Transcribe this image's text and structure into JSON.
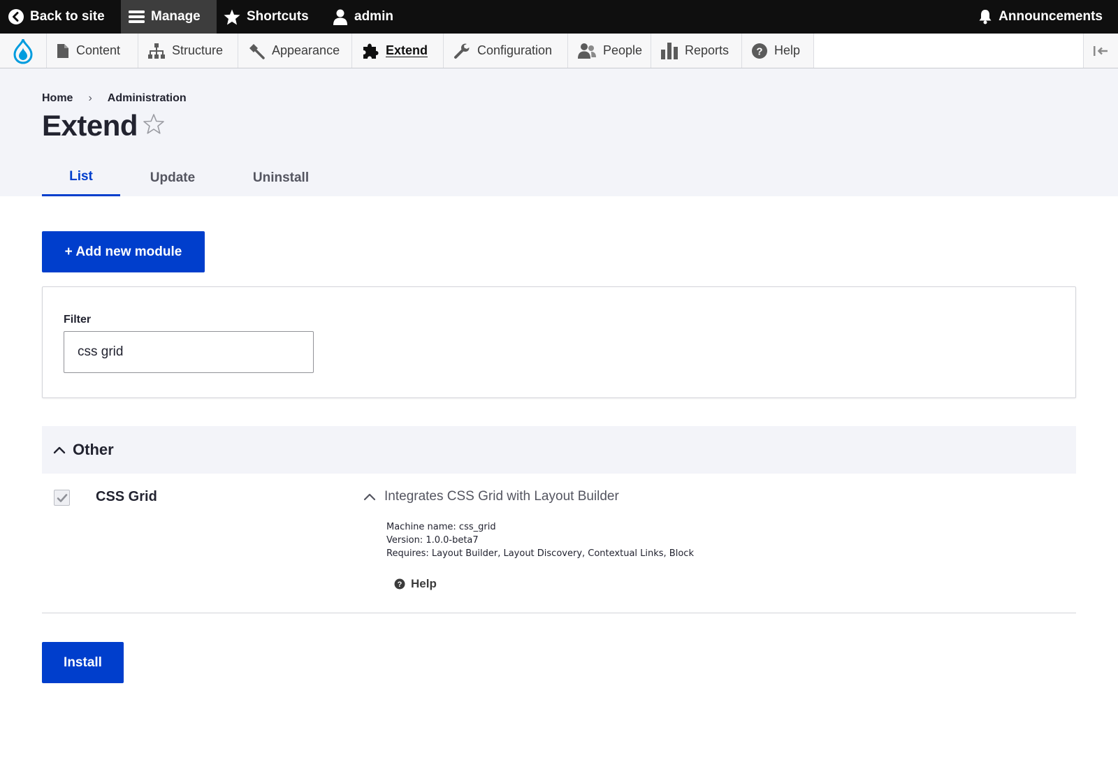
{
  "toolbar": {
    "back_label": "Back to site",
    "manage_label": "Manage",
    "shortcuts_label": "Shortcuts",
    "user_label": "admin",
    "announcements_label": "Announcements"
  },
  "tray": {
    "items": [
      {
        "label": "Content",
        "icon": "content-icon"
      },
      {
        "label": "Structure",
        "icon": "structure-icon"
      },
      {
        "label": "Appearance",
        "icon": "appearance-icon"
      },
      {
        "label": "Extend",
        "icon": "extend-icon",
        "active": true
      },
      {
        "label": "Configuration",
        "icon": "wrench-icon"
      },
      {
        "label": "People",
        "icon": "people-icon"
      },
      {
        "label": "Reports",
        "icon": "reports-icon"
      },
      {
        "label": "Help",
        "icon": "help-icon"
      }
    ]
  },
  "breadcrumb": {
    "home": "Home",
    "separator": "›",
    "current": "Administration"
  },
  "page": {
    "title": "Extend"
  },
  "tabs": [
    {
      "label": "List",
      "active": true
    },
    {
      "label": "Update"
    },
    {
      "label": "Uninstall"
    }
  ],
  "actions": {
    "add_module_label": "+ Add new module",
    "install_label": "Install"
  },
  "filter": {
    "label": "Filter",
    "value": "css grid"
  },
  "group": {
    "label": "Other"
  },
  "module": {
    "name": "CSS Grid",
    "checked": true,
    "description": "Integrates CSS Grid with Layout Builder",
    "machine_name": "Machine name: css_grid",
    "version": "Version: 1.0.0-beta7",
    "requires": "Requires: Layout Builder, Layout Discovery, Contextual Links, Block",
    "help_label": "Help"
  },
  "colors": {
    "accent": "#003ecc",
    "toolbar_bg": "#0f0f0f",
    "header_bg": "#f3f4f9",
    "drupal_blue": "#009cde"
  }
}
